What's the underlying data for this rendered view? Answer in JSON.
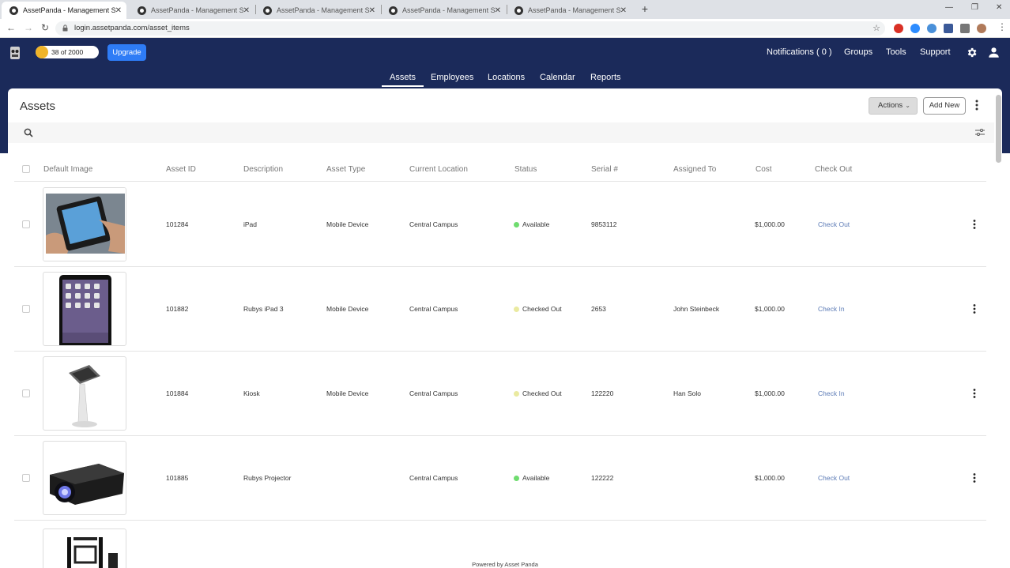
{
  "browser": {
    "tabs": [
      {
        "title": "AssetPanda - Management Syste",
        "active": true
      },
      {
        "title": "AssetPanda - Management Syste",
        "active": false
      },
      {
        "title": "AssetPanda - Management Syste",
        "active": false
      },
      {
        "title": "AssetPanda - Management Syste",
        "active": false
      },
      {
        "title": "AssetPanda - Management Syste",
        "active": false
      }
    ],
    "url": "login.assetpanda.com/asset_items"
  },
  "header": {
    "usage": "38 of 2000",
    "upgrade_label": "Upgrade",
    "notifications": "Notifications ( 0 )",
    "groups": "Groups",
    "tools": "Tools",
    "support": "Support"
  },
  "nav": {
    "assets": "Assets",
    "employees": "Employees",
    "locations": "Locations",
    "calendar": "Calendar",
    "reports": "Reports"
  },
  "page": {
    "title": "Assets",
    "actions_label": "Actions",
    "add_new_label": "Add New"
  },
  "table": {
    "columns": {
      "image": "Default Image",
      "asset_id": "Asset ID",
      "description": "Description",
      "asset_type": "Asset Type",
      "location": "Current Location",
      "status": "Status",
      "serial": "Serial #",
      "assigned": "Assigned To",
      "cost": "Cost",
      "checkout": "Check Out"
    },
    "rows": [
      {
        "asset_id": "101284",
        "description": "iPad",
        "asset_type": "Mobile Device",
        "location": "Central Campus",
        "status": "Available",
        "serial": "9853112",
        "assigned": "",
        "cost": "$1,000.00",
        "action": "Check Out"
      },
      {
        "asset_id": "101882",
        "description": "Rubys iPad 3",
        "asset_type": "Mobile Device",
        "location": "Central Campus",
        "status": "Checked Out",
        "serial": "2653",
        "assigned": "John Steinbeck",
        "cost": "$1,000.00",
        "action": "Check In"
      },
      {
        "asset_id": "101884",
        "description": "Kiosk",
        "asset_type": "Mobile Device",
        "location": "Central Campus",
        "status": "Checked Out",
        "serial": "122220",
        "assigned": "Han Solo",
        "cost": "$1,000.00",
        "action": "Check In"
      },
      {
        "asset_id": "101885",
        "description": "Rubys Projector",
        "asset_type": "",
        "location": "Central Campus",
        "status": "Available",
        "serial": "122222",
        "assigned": "",
        "cost": "$1,000.00",
        "action": "Check Out"
      }
    ]
  },
  "colors": {
    "header_bg": "#1b2a5a",
    "upgrade_blue": "#2e7cf6",
    "available_green": "#6fdc6f",
    "checked_out_yellow": "#eaeaa0",
    "link_blue": "#5c7bb6"
  },
  "footer": {
    "text": "Powered by Asset Panda"
  }
}
